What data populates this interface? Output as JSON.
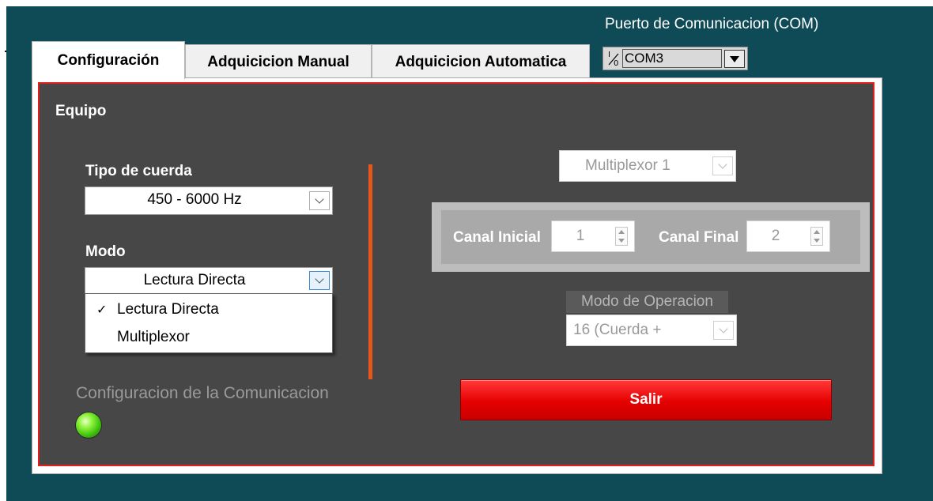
{
  "com": {
    "label": "Puerto de Comunicacion (COM)",
    "io_glyph": "I/0",
    "value": "COM3"
  },
  "tabs": [
    {
      "label": "Configuración",
      "active": true
    },
    {
      "label": "Adquicicion Manual",
      "active": false
    },
    {
      "label": "Adquicicion Automatica",
      "active": false
    }
  ],
  "equipo": {
    "title": "Equipo",
    "tipo_cuerda": {
      "label": "Tipo de cuerda",
      "value": "450 - 6000 Hz"
    },
    "modo": {
      "label": "Modo",
      "value": "Lectura Directa",
      "options": [
        {
          "label": "Lectura Directa",
          "checked": true
        },
        {
          "label": "Multiplexor",
          "checked": false
        }
      ]
    }
  },
  "comunicacion": {
    "label": "Configuracion de la Comunicacion",
    "led_color": "#3fc20f",
    "led_on": true
  },
  "multiplexor": {
    "value": "Multiplexor 1"
  },
  "canal": {
    "inicial_label": "Canal Inicial",
    "inicial_value": "1",
    "final_label": "Canal Final",
    "final_value": "2"
  },
  "modo_operacion": {
    "label": "Modo de Operacion",
    "value": "16 (Cuerda +"
  },
  "salir": {
    "label": "Salir"
  },
  "colors": {
    "background": "#0f4a57",
    "panel": "#474747",
    "frame": "#e41c1c",
    "divider": "#e8561c",
    "exit_button": "#e60000"
  }
}
